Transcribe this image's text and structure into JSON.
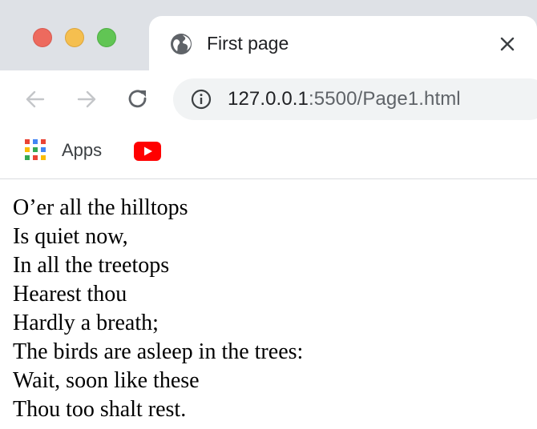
{
  "window": {
    "traffic_lights": {
      "close": "#ed6a5e",
      "minimize": "#f5bf4f",
      "zoom": "#61c554"
    }
  },
  "tab": {
    "title": "First page",
    "favicon": "globe-icon",
    "close_icon": "close-icon"
  },
  "toolbar": {
    "back_icon": "arrow-left-icon",
    "forward_icon": "arrow-right-icon",
    "reload_icon": "reload-icon",
    "omnibox": {
      "info_icon": "info-icon",
      "url_host": "127.0.0.1",
      "url_rest": ":5500/Page1.html"
    }
  },
  "bookmarks": {
    "apps_label": "Apps",
    "apps_icon": "apps-grid-icon",
    "youtube_icon": "youtube-icon"
  },
  "content": {
    "lines": [
      "O’er all the hilltops",
      "Is quiet now,",
      "In all the treetops",
      "Hearest thou",
      "Hardly a breath;",
      "The birds are asleep in the trees:",
      "Wait, soon like these",
      "Thou too shalt rest."
    ]
  }
}
